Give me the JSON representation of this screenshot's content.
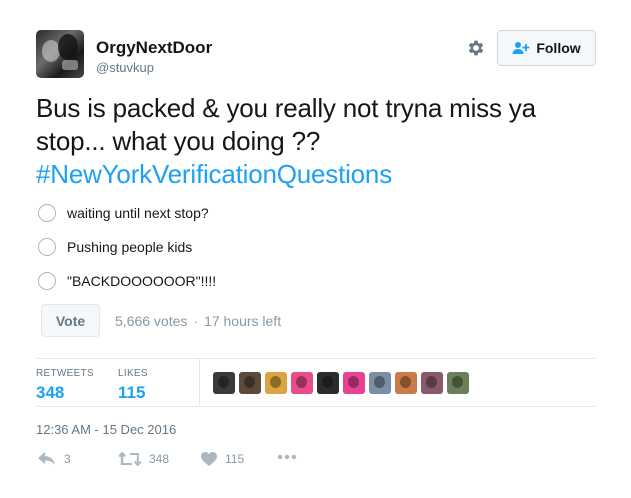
{
  "user": {
    "display_name": "OrgyNextDoor",
    "username": "@stuvkup"
  },
  "header": {
    "follow_label": "Follow",
    "gear_icon": "gear-icon",
    "follow_icon": "person-plus-icon"
  },
  "tweet": {
    "text": "Bus is packed & you really not tryna miss ya stop... what you doing ??",
    "hashtag": "#NewYorkVerificationQuestions"
  },
  "poll": {
    "options": [
      {
        "label": "waiting until next stop?"
      },
      {
        "label": "Pushing people kids"
      },
      {
        "label": "\"BACKDOOOOOOR\"!!!!"
      }
    ],
    "vote_label": "Vote",
    "votes": "5,666 votes",
    "separator": "·",
    "time_left": "17 hours left"
  },
  "stats": {
    "retweets_label": "RETWEETS",
    "retweets_value": "348",
    "likes_label": "LIKES",
    "likes_value": "115",
    "liker_colors": [
      "#3a3a3a",
      "#5c4b3a",
      "#d9a441",
      "#e94c8a",
      "#2c2c2c",
      "#e84393",
      "#7a8fa6",
      "#c97b4a",
      "#8a5a6a",
      "#6a7f5a"
    ]
  },
  "timestamp": "12:36 AM - 15 Dec 2016",
  "actions": {
    "reply_count": "3",
    "retweet_count": "348",
    "like_count": "115"
  },
  "colors": {
    "accent": "#1da1f2",
    "muted": "#657786",
    "icon_muted": "#aab8c2"
  }
}
